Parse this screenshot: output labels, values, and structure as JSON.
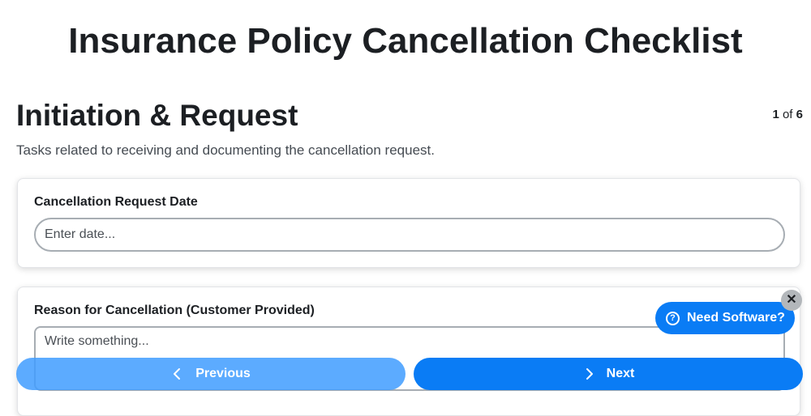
{
  "page": {
    "title": "Insurance Policy Cancellation Checklist"
  },
  "section": {
    "title": "Initiation & Request",
    "description": "Tasks related to receiving and documenting the cancellation request.",
    "step_current": "1",
    "step_of": "of",
    "step_total": "6"
  },
  "fields": [
    {
      "label": "Cancellation Request Date",
      "placeholder": "Enter date...",
      "value": ""
    },
    {
      "label": "Reason for Cancellation (Customer Provided)",
      "placeholder": "Write something...",
      "value": ""
    }
  ],
  "nav": {
    "previous_label": "Previous",
    "previous_icon": "chevron-left-icon",
    "next_label": "Next",
    "next_icon": "chevron-right-icon"
  },
  "promo": {
    "label": "Need Software?",
    "icon": "question-circle-icon",
    "icon_glyph": "?",
    "close_glyph": "✕",
    "close_icon": "close-icon"
  },
  "colors": {
    "primary": "#0a7cf5",
    "primary_disabled": "#409cff",
    "input_border": "#a7adb3",
    "close_bg": "#b3b7bb"
  }
}
